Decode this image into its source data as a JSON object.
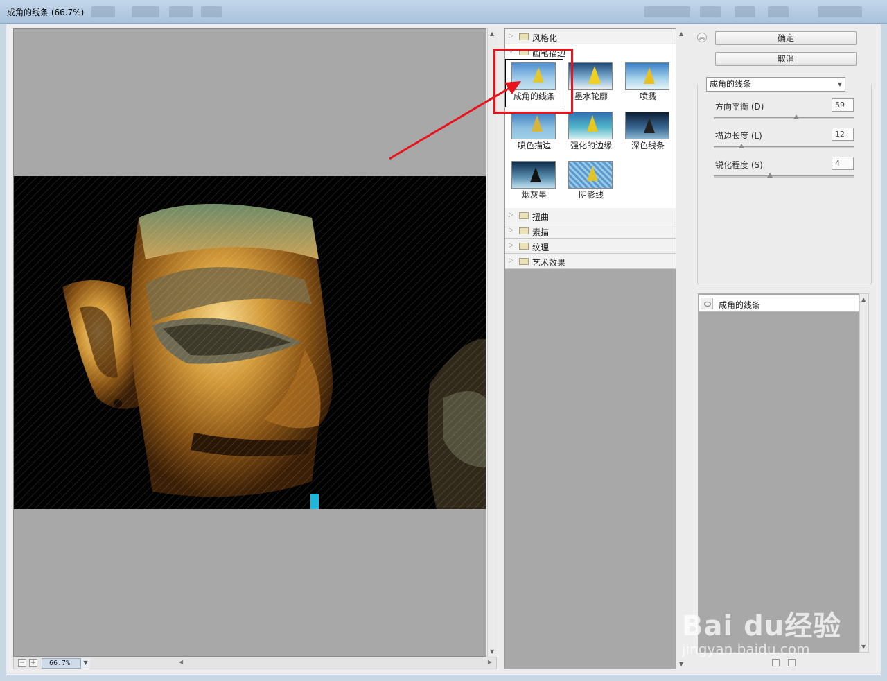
{
  "window": {
    "title": "成角的线条 (66.7%)"
  },
  "preview": {
    "zoom": "66.7%"
  },
  "gallery": {
    "categories": [
      {
        "label": "风格化",
        "expanded": false
      },
      {
        "label": "画笔描边",
        "expanded": true
      },
      {
        "label": "扭曲",
        "expanded": false
      },
      {
        "label": "素描",
        "expanded": false
      },
      {
        "label": "纹理",
        "expanded": false
      },
      {
        "label": "艺术效果",
        "expanded": false
      }
    ],
    "filters": [
      {
        "label": "成角的线条",
        "selected": true
      },
      {
        "label": "墨水轮廓",
        "selected": false
      },
      {
        "label": "喷溅",
        "selected": false
      },
      {
        "label": "喷色描边",
        "selected": false
      },
      {
        "label": "强化的边缘",
        "selected": false
      },
      {
        "label": "深色线条",
        "selected": false
      },
      {
        "label": "烟灰墨",
        "selected": false
      },
      {
        "label": "阴影线",
        "selected": false
      }
    ]
  },
  "actions": {
    "ok_label": "确定",
    "cancel_label": "取消"
  },
  "settings": {
    "filter_select": "成角的线条",
    "params": [
      {
        "label": "方向平衡 (D)",
        "value": "59",
        "fraction": 0.59
      },
      {
        "label": "描边长度 (L)",
        "value": "12",
        "fraction": 0.2
      },
      {
        "label": "锐化程度 (S)",
        "value": "4",
        "fraction": 0.4
      }
    ]
  },
  "layers": {
    "items": [
      {
        "label": "成角的线条"
      }
    ]
  },
  "watermark": {
    "brand": "Bai du经验",
    "url": "jingyan.baidu.com"
  },
  "colors": {
    "annotation": "#e8131b",
    "preview_bg": "#a8a8a8"
  }
}
